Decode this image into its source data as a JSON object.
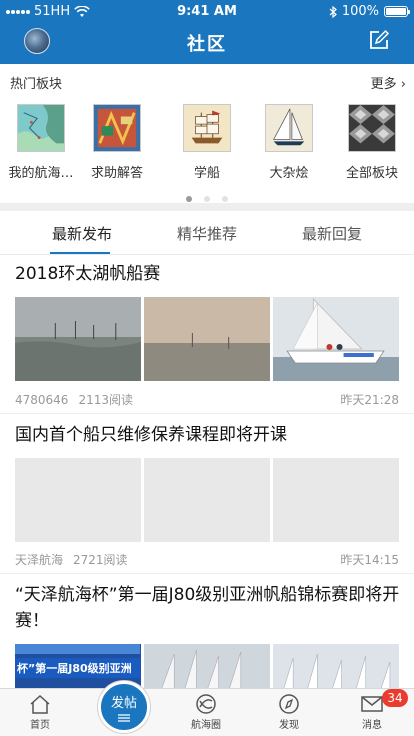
{
  "status_bar": {
    "carrier": "51HH",
    "time": "9:41 AM",
    "battery": "100%"
  },
  "navbar": {
    "title": "社区",
    "compose_icon": "compose-icon"
  },
  "hot_boards": {
    "title": "热门板块",
    "more": "更多 ›",
    "items": [
      {
        "label": "我的航海…",
        "icon": "nautical-chart-thumbnail"
      },
      {
        "label": "求助解答",
        "icon": "colorful-map-thumbnail"
      },
      {
        "label": "学船",
        "icon": "ship-sketch-thumbnail"
      },
      {
        "label": "大杂烩",
        "icon": "sailboat-thumbnail"
      },
      {
        "label": "全部板块",
        "icon": "metal-gears-thumbnail"
      }
    ],
    "page_count": 3,
    "active_page": 0
  },
  "tabs": [
    "最新发布",
    "精华推荐",
    "最新回复"
  ],
  "active_tab": 0,
  "posts": [
    {
      "title": "2018环太湖帆船赛",
      "author": "4780646",
      "views": "2113阅读",
      "time": "昨天21:28",
      "images": [
        "misty-lake-sailboats-photo",
        "hazy-sunset-sailboats-photo",
        "racing-yacht-crew-photo"
      ]
    },
    {
      "title": "国内首个船只维修保养课程即将开课",
      "author": "天泽航海",
      "views": "2721阅读",
      "time": "昨天14:15",
      "images": [
        "placeholder-image",
        "placeholder-image",
        "placeholder-image"
      ]
    },
    {
      "title": "“天泽航海杯”第一届J80级别亚洲帆船锦标赛即将开赛！",
      "banner_text": "杯”第一届J80级别亚洲",
      "images": [
        "event-banner-photo",
        "white-sails-fleet-photo",
        "sailboat-masts-photo"
      ]
    }
  ],
  "tabbar": {
    "items": [
      {
        "label": "首页",
        "icon": "home-icon"
      },
      {
        "label": "发帖",
        "icon": "post-icon"
      },
      {
        "label": "航海圈",
        "icon": "sailing-circle-icon"
      },
      {
        "label": "发现",
        "icon": "compass-icon"
      },
      {
        "label": "消息",
        "icon": "mail-icon"
      }
    ],
    "message_badge": "34"
  },
  "colors": {
    "brand_blue": "#1a76bf",
    "badge_red": "#ea3b2f"
  }
}
